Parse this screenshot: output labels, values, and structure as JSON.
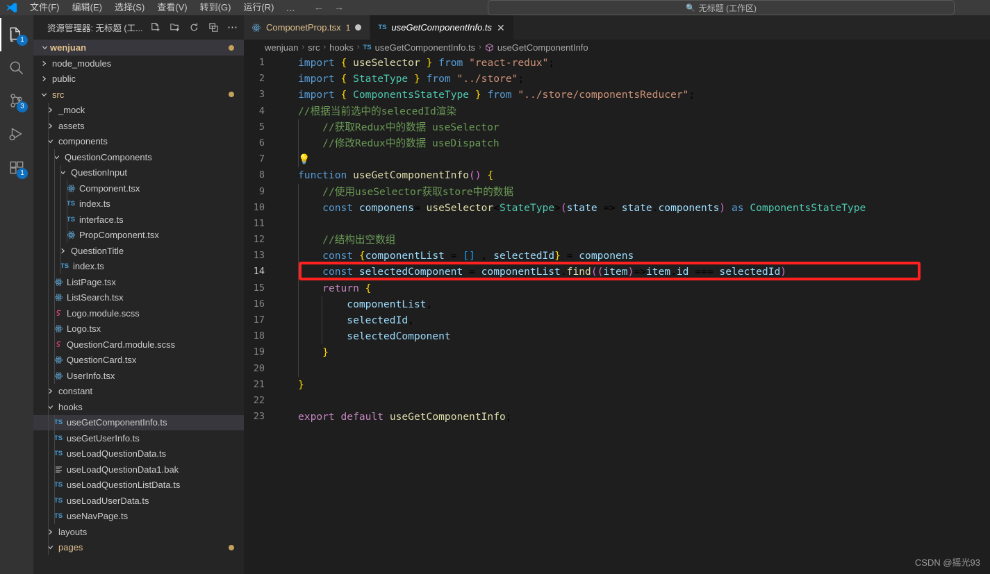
{
  "titlebar": {
    "menu": [
      {
        "label": "文件(F)"
      },
      {
        "label": "编辑(E)"
      },
      {
        "label": "选择(S)"
      },
      {
        "label": "查看(V)"
      },
      {
        "label": "转到(G)"
      },
      {
        "label": "运行(R)"
      }
    ],
    "more_label": "…",
    "back_arrow": "←",
    "forward_arrow": "→",
    "quick_search": {
      "icon": "search-icon",
      "value": "无标题 (工作区)"
    }
  },
  "activitybar": {
    "items": [
      {
        "name": "explorer",
        "icon": "files-icon",
        "badge": "1",
        "active": true
      },
      {
        "name": "search",
        "icon": "search-icon",
        "badge": "",
        "active": false
      },
      {
        "name": "source-control",
        "icon": "source-control-icon",
        "badge": "3",
        "active": false
      },
      {
        "name": "run-debug",
        "icon": "run-debug-icon",
        "badge": "",
        "active": false
      },
      {
        "name": "extensions",
        "icon": "extensions-icon",
        "badge": "1",
        "active": false
      }
    ]
  },
  "sidebar": {
    "title": "资源管理器: 无标题 (工...",
    "actions": [
      {
        "name": "new-file-icon",
        "title": "新建文件"
      },
      {
        "name": "new-folder-icon",
        "title": "新建文件夹"
      },
      {
        "name": "refresh-icon",
        "title": "刷新"
      },
      {
        "name": "collapse-all-icon",
        "title": "全部折叠"
      },
      {
        "name": "more-actions-icon",
        "title": "更多操作",
        "glyph": "⋯"
      }
    ],
    "root": {
      "label": "wenjuan",
      "expanded": true,
      "dirty": true
    },
    "tree": [
      {
        "label": "node_modules",
        "type": "folder",
        "expanded": false,
        "depth": 1
      },
      {
        "label": "public",
        "type": "folder",
        "expanded": false,
        "depth": 1
      },
      {
        "label": "src",
        "type": "folder",
        "expanded": true,
        "depth": 1,
        "modified": true,
        "dot": true
      },
      {
        "label": "_mock",
        "type": "folder",
        "expanded": false,
        "depth": 2
      },
      {
        "label": "assets",
        "type": "folder",
        "expanded": false,
        "depth": 2
      },
      {
        "label": "components",
        "type": "folder",
        "expanded": true,
        "depth": 2
      },
      {
        "label": "QuestionComponents",
        "type": "folder",
        "expanded": true,
        "depth": 3
      },
      {
        "label": "QuestionInput",
        "type": "folder",
        "expanded": true,
        "depth": 4
      },
      {
        "label": "Component.tsx",
        "type": "react",
        "depth": 5
      },
      {
        "label": "index.ts",
        "type": "ts",
        "depth": 5
      },
      {
        "label": "interface.ts",
        "type": "ts",
        "depth": 5
      },
      {
        "label": "PropComponent.tsx",
        "type": "react",
        "depth": 5
      },
      {
        "label": "QuestionTitle",
        "type": "folder",
        "expanded": false,
        "depth": 4
      },
      {
        "label": "index.ts",
        "type": "ts",
        "depth": 4
      },
      {
        "label": "ListPage.tsx",
        "type": "react",
        "depth": 3
      },
      {
        "label": "ListSearch.tsx",
        "type": "react",
        "depth": 3
      },
      {
        "label": "Logo.module.scss",
        "type": "scss",
        "depth": 3
      },
      {
        "label": "Logo.tsx",
        "type": "react",
        "depth": 3
      },
      {
        "label": "QuestionCard.module.scss",
        "type": "scss",
        "depth": 3
      },
      {
        "label": "QuestionCard.tsx",
        "type": "react",
        "depth": 3
      },
      {
        "label": "UserInfo.tsx",
        "type": "react",
        "depth": 3
      },
      {
        "label": "constant",
        "type": "folder",
        "expanded": false,
        "depth": 2
      },
      {
        "label": "hooks",
        "type": "folder",
        "expanded": true,
        "depth": 2
      },
      {
        "label": "useGetComponentInfo.ts",
        "type": "ts",
        "depth": 3,
        "selected": true
      },
      {
        "label": "useGetUserInfo.ts",
        "type": "ts",
        "depth": 3
      },
      {
        "label": "useLoadQuestionData.ts",
        "type": "ts",
        "depth": 3
      },
      {
        "label": "useLoadQuestionData1.bak",
        "type": "bak",
        "depth": 3
      },
      {
        "label": "useLoadQuestionListData.ts",
        "type": "ts",
        "depth": 3
      },
      {
        "label": "useLoadUserData.ts",
        "type": "ts",
        "depth": 3
      },
      {
        "label": "useNavPage.ts",
        "type": "ts",
        "depth": 3
      },
      {
        "label": "layouts",
        "type": "folder",
        "expanded": false,
        "depth": 2
      },
      {
        "label": "pages",
        "type": "folder",
        "expanded": true,
        "depth": 2,
        "modified": true,
        "dot": true
      }
    ]
  },
  "editor": {
    "tabs": [
      {
        "label": "ComponetProp.tsx",
        "icon": "react-icon",
        "count": "1",
        "dirty": true,
        "active": false,
        "modified": true
      },
      {
        "label": "useGetComponentInfo.ts",
        "icon": "ts-icon",
        "active": true,
        "close": "✕"
      }
    ],
    "breadcrumb": [
      {
        "label": "wenjuan",
        "icon": ""
      },
      {
        "label": "src",
        "icon": ""
      },
      {
        "label": "hooks",
        "icon": ""
      },
      {
        "label": "useGetComponentInfo.ts",
        "icon": "ts-icon"
      },
      {
        "label": "useGetComponentInfo",
        "icon": "symbol-method-icon"
      }
    ],
    "breadcrumb_separator": "›",
    "lines": [
      {
        "n": "1",
        "guides": 0,
        "indent": 0
      },
      {
        "n": "2",
        "guides": 0,
        "indent": 0
      },
      {
        "n": "3",
        "guides": 0,
        "indent": 0
      },
      {
        "n": "4",
        "guides": 0,
        "indent": 0
      },
      {
        "n": "5",
        "guides": 1,
        "indent": 0
      },
      {
        "n": "6",
        "guides": 1,
        "indent": 0
      },
      {
        "n": "7",
        "guides": 1,
        "indent": 0
      },
      {
        "n": "8",
        "guides": 0,
        "indent": 0
      },
      {
        "n": "9",
        "guides": 1,
        "indent": 0
      },
      {
        "n": "10",
        "guides": 1,
        "indent": 0
      },
      {
        "n": "11",
        "guides": 1,
        "indent": 0
      },
      {
        "n": "12",
        "guides": 1,
        "indent": 0
      },
      {
        "n": "13",
        "guides": 1,
        "indent": 0
      },
      {
        "n": "14",
        "guides": 1,
        "indent": 0
      },
      {
        "n": "15",
        "guides": 1,
        "indent": 0
      },
      {
        "n": "16",
        "guides": 2,
        "indent": 0
      },
      {
        "n": "17",
        "guides": 2,
        "indent": 0
      },
      {
        "n": "18",
        "guides": 2,
        "indent": 0
      },
      {
        "n": "19",
        "guides": 1,
        "indent": 0
      },
      {
        "n": "20",
        "guides": 1,
        "indent": 0
      },
      {
        "n": "21",
        "guides": 0,
        "indent": 0
      },
      {
        "n": "22",
        "guides": 0,
        "indent": 0
      },
      {
        "n": "23",
        "guides": 0,
        "indent": 0
      }
    ],
    "source_text": [
      "import { useSelector } from \"react-redux\";",
      "import { StateType } from \"../store\";",
      "import { ComponentsStateType } from \"../store/componentsReducer\";",
      "//根据当前选中的selecedId渲染",
      "    //获取Redux中的数据 useSelector",
      "    //修改Redux中的数据 useDispatch",
      "",
      "function useGetComponentInfo() {",
      "    //使用useSelector获取store中的数据",
      "    const componens= useSelector<StateType>(state => state.components) as ComponentsStateType",
      "",
      "    //结构出空数组",
      "    const {componentList = [] , selectedId} = componens",
      "    const selectedComponent = componentList.find((item)=>item.id === selectedId)",
      "    return {",
      "        componentList,",
      "        selectedId,",
      "        selectedComponent",
      "    }",
      "",
      "}",
      "",
      "export default useGetComponentInfo;"
    ],
    "annotation": {
      "type": "red-rectangle",
      "line": "14",
      "color": "#ff2020"
    },
    "lightbulb_line": "7"
  },
  "watermark": "CSDN @摇光93",
  "colors": {
    "accent": "#0e70c0",
    "modified": "#e2c08d",
    "annotation": "#ff2020",
    "editor_bg": "#1e1e1e",
    "sidebar_bg": "#252526",
    "activitybar_bg": "#333333"
  }
}
